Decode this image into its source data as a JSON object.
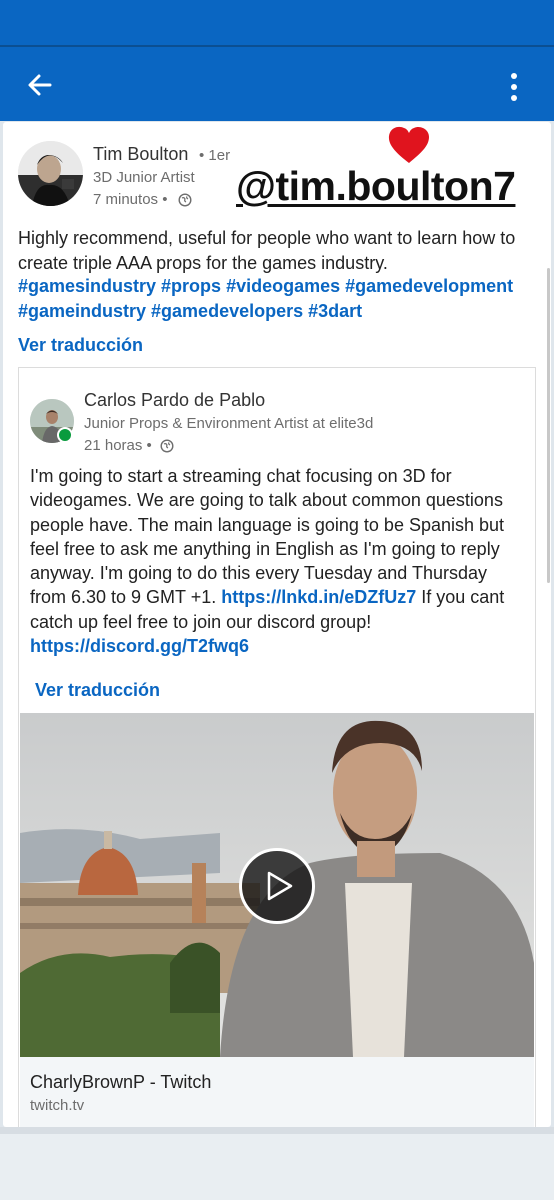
{
  "header": {
    "back_icon": "arrow-left-icon",
    "more_icon": "more-vertical-icon",
    "colors": {
      "brand": "#0a66c2"
    }
  },
  "post": {
    "author_name": "Tim Boulton",
    "degree": "• 1er",
    "author_title": "3D Junior Artist",
    "time": "7 minutos •",
    "text": "Highly recommend, useful for people who want to learn how to create triple AAA props for the games industry.",
    "hashtags": "#gamesindustry #props #videogames #gamedevelopment #gameindustry #gamedevelopers #3dart",
    "translate_label": "Ver traducción"
  },
  "overlay": {
    "handle": "@tim.boulton7",
    "heart_icon": "heart-icon"
  },
  "shared_post": {
    "author_name": "Carlos Pardo de Pablo",
    "author_title": "Junior Props & Environment Artist at elite3d",
    "time": "21 horas •",
    "text_1": "I'm going to start a streaming chat focusing on 3D for videogames. We are going to talk about common questions people have. The main language is going to be Spanish but feel free to ask me anything in English as I'm going to reply anyway. I'm going to do this every Tuesday and Thursday from 6.30 to 9 GMT +1. ",
    "link_1": "https://lnkd.in/eDZfUz7",
    "text_2": " If you cant catch up feel free to join our discord group! ",
    "link_2": "https://discord.gg/T2fwq6",
    "translate_label": "Ver traducción",
    "video": {
      "play_icon": "play-icon",
      "link_title": "CharlyBrownP - Twitch",
      "link_domain": "twitch.tv"
    }
  }
}
